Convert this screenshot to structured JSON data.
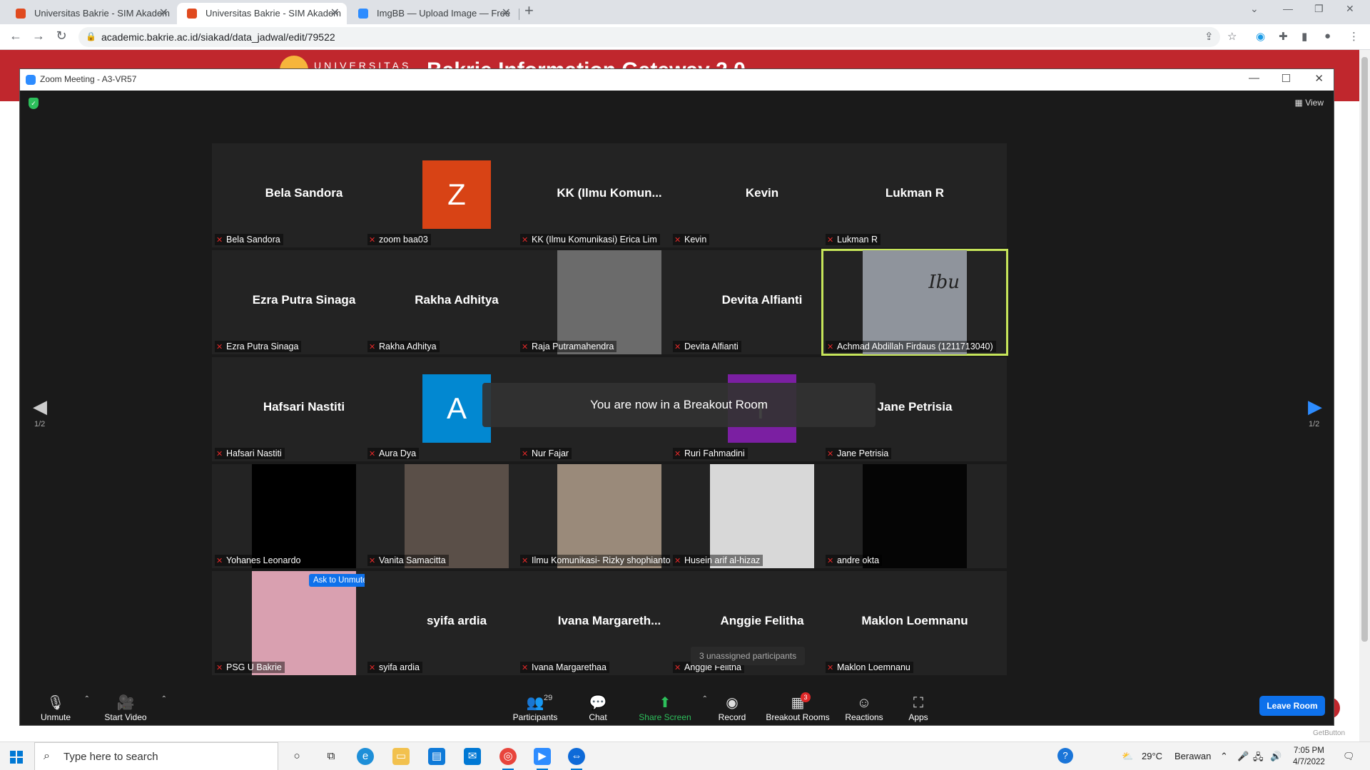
{
  "browser": {
    "tabs": [
      {
        "title": "Universitas Bakrie - SIM Akadem",
        "active": false,
        "favicon_color": "#e04a1f"
      },
      {
        "title": "Universitas Bakrie - SIM Akadem",
        "active": true,
        "favicon_color": "#e04a1f"
      },
      {
        "title": "ImgBB — Upload Image — Free",
        "active": false,
        "favicon_color": "#2d8cff"
      }
    ],
    "url": "academic.bakrie.ac.id/siakad/data_jadwal/edit/79522"
  },
  "webpage": {
    "header_brand": "UNIVERSITAS",
    "header_title": "Bakrie Information Gateway 2.0",
    "brand_color": "#c0272d",
    "footer_text": "GetButton"
  },
  "zoom": {
    "window_title": "Zoom Meeting - A3-VR57",
    "view_label": "View",
    "page_indicator": "1/2",
    "toast": "You are now in a Breakout Room",
    "unassigned_tip": "3 unassigned participants",
    "ask_to_unmute": "Ask to Unmute",
    "more_label": "···",
    "participants": [
      {
        "big": "Bela Sandora",
        "label": "Bela Sandora",
        "kind": "name"
      },
      {
        "big": "Z",
        "label": "zoom baa03",
        "kind": "avatar",
        "color": "#d84315"
      },
      {
        "big": "KK  (Ilmu  Komun...",
        "label": "KK (Ilmu Komunikasi) Erica Lim",
        "kind": "name"
      },
      {
        "big": "Kevin",
        "label": "Kevin",
        "kind": "name"
      },
      {
        "big": "Lukman R",
        "label": "Lukman R",
        "kind": "name"
      },
      {
        "big": "Ezra Putra Sinaga",
        "label": "Ezra Putra Sinaga",
        "kind": "name"
      },
      {
        "big": "Rakha Adhitya",
        "label": "Rakha Adhitya",
        "kind": "name"
      },
      {
        "big": "",
        "label": "Raja Putramahendra",
        "kind": "photo",
        "color": "#6b6b6b"
      },
      {
        "big": "Devita Alfianti",
        "label": "Devita Alfianti",
        "kind": "name"
      },
      {
        "big": "Ibu",
        "label": "Achmad Abdillah Firdaus (1211713040)",
        "kind": "photo",
        "color": "#8f949c",
        "active": true
      },
      {
        "big": "Hafsari Nastiti",
        "label": "Hafsari Nastiti",
        "kind": "name"
      },
      {
        "big": "A",
        "label": "Aura Dya",
        "kind": "avatar",
        "color": "#0288d1"
      },
      {
        "big": "",
        "label": "Nur Fajar",
        "kind": "name"
      },
      {
        "big": "r",
        "label": "Ruri Fahmadini",
        "kind": "avatar",
        "color": "#7b1fa2"
      },
      {
        "big": "Jane Petrisia",
        "label": "Jane Petrisia",
        "kind": "name"
      },
      {
        "big": "",
        "label": "Yohanes Leonardo",
        "kind": "photo",
        "color": "#000000"
      },
      {
        "big": "",
        "label": "Vanita Samacitta",
        "kind": "photo",
        "color": "#5a4f48"
      },
      {
        "big": "",
        "label": "Ilmu Komunikasi- Rizky shophianto",
        "kind": "photo",
        "color": "#9a8a7a"
      },
      {
        "big": "",
        "label": "Husein arif al-hizaz",
        "kind": "photo",
        "color": "#d8d8d8"
      },
      {
        "big": "",
        "label": "andre okta",
        "kind": "photo",
        "color": "#050505"
      },
      {
        "big": "",
        "label": "PSG U Bakrie",
        "kind": "photo",
        "color": "#d9a0b0"
      },
      {
        "big": "syifa ardia",
        "label": "syifa ardia",
        "kind": "name"
      },
      {
        "big": "Ivana  Margareth...",
        "label": "Ivana Margarethaa",
        "kind": "name"
      },
      {
        "big": "Anggie Felitha",
        "label": "Anggie Felitha",
        "kind": "name"
      },
      {
        "big": "Maklon Loemnanu",
        "label": "Maklon Loemnanu",
        "kind": "name"
      }
    ],
    "controls": {
      "unmute": "Unmute",
      "start_video": "Start Video",
      "participants": "Participants",
      "participant_count": "29",
      "chat": "Chat",
      "share_screen": "Share Screen",
      "record": "Record",
      "breakout_rooms": "Breakout Rooms",
      "breakout_badge": "3",
      "reactions": "Reactions",
      "apps": "Apps",
      "leave_room": "Leave Room"
    },
    "active_speaker_color": "#c6e55a",
    "accent_color": "#0e71eb"
  },
  "taskbar": {
    "search_placeholder": "Type here to search",
    "weather_temp": "29°C",
    "weather_desc": "Berawan",
    "time": "7:05 PM",
    "date": "4/7/2022",
    "icons": [
      "cortana-icon",
      "task-view-icon",
      "edge-icon",
      "file-explorer-icon",
      "store-icon",
      "mail-icon",
      "chrome-icon",
      "zoom-icon",
      "teamviewer-icon"
    ]
  }
}
